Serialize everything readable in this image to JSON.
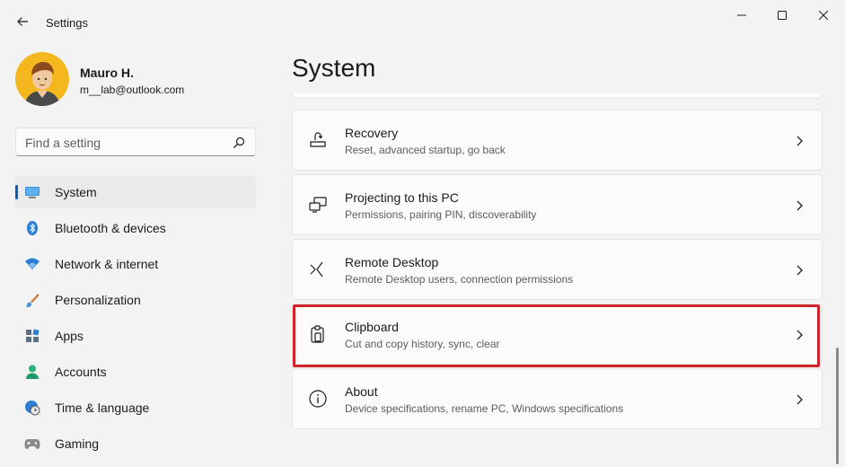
{
  "app": {
    "title": "Settings"
  },
  "user": {
    "name": "Mauro H.",
    "email": "m__lab@outlook.com"
  },
  "search": {
    "placeholder": "Find a setting"
  },
  "nav": {
    "items": [
      {
        "label": "System",
        "icon": "monitor-icon",
        "selected": true
      },
      {
        "label": "Bluetooth & devices",
        "icon": "bluetooth-icon"
      },
      {
        "label": "Network & internet",
        "icon": "wifi-icon"
      },
      {
        "label": "Personalization",
        "icon": "brush-icon"
      },
      {
        "label": "Apps",
        "icon": "apps-icon"
      },
      {
        "label": "Accounts",
        "icon": "person-icon"
      },
      {
        "label": "Time & language",
        "icon": "globe-clock-icon"
      },
      {
        "label": "Gaming",
        "icon": "gamepad-icon"
      }
    ]
  },
  "main": {
    "title": "System",
    "cards": [
      {
        "title": "Recovery",
        "desc": "Reset, advanced startup, go back",
        "icon": "recovery-icon"
      },
      {
        "title": "Projecting to this PC",
        "desc": "Permissions, pairing PIN, discoverability",
        "icon": "projecting-icon"
      },
      {
        "title": "Remote Desktop",
        "desc": "Remote Desktop users, connection permissions",
        "icon": "remote-desktop-icon"
      },
      {
        "title": "Clipboard",
        "desc": "Cut and copy history, sync, clear",
        "icon": "clipboard-icon",
        "highlighted": true
      },
      {
        "title": "About",
        "desc": "Device specifications, rename PC, Windows specifications",
        "icon": "info-icon"
      }
    ]
  },
  "colors": {
    "accent": "#005fb8",
    "highlight": "#d1232a",
    "background": "#f3f3f3",
    "card": "#fbfbfb"
  }
}
